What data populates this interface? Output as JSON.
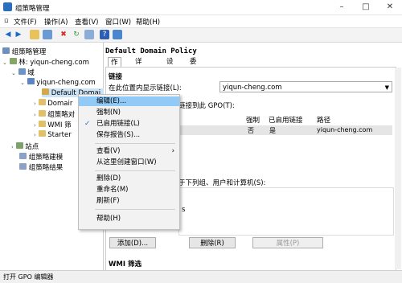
{
  "window": {
    "title": "组策略管理",
    "controls": [
      "–",
      "□",
      "✕"
    ]
  },
  "menubar": [
    {
      "label": "文件(F)"
    },
    {
      "label": "操作(A)"
    },
    {
      "label": "查看(V)"
    },
    {
      "label": "窗口(W)"
    },
    {
      "label": "帮助(H)"
    }
  ],
  "tree": {
    "root": "组策略管理",
    "forest": "林: yiqun-cheng.com",
    "domains": "域",
    "domain": "yiqun-cheng.com",
    "gpo": "Default Domai",
    "domain_ctrl": "Domair",
    "gpo_objects": "组策略对",
    "wmi": "WMI 筛",
    "starter": "Starter",
    "sites": "站点",
    "modeling": "组策略建模",
    "results": "组策略结果"
  },
  "right": {
    "gpo_title": "Default Domain Policy",
    "tabs": [
      "作用域",
      "详细信息",
      "设置",
      "委派"
    ],
    "links_header": "链接",
    "location_label": "在此位置内显示链接(L):",
    "location_value": "yiqun-cheng.com",
    "linked_label": "链接到此 GPO(T):",
    "table_headers": [
      "强制",
      "已启用链接",
      "路径"
    ],
    "table_row": {
      "enforced": "否",
      "enabled": "是",
      "path": "yiqun-cheng.com"
    },
    "filter_text": "于下列组、用户和计算机(S):",
    "filter_item": "s",
    "btn_add": "添加(D)...",
    "btn_remove": "删除(R)",
    "btn_props": "属性(P)",
    "wmi_header": "WMI 筛选"
  },
  "context_menu": [
    {
      "label": "编辑(E)...",
      "highlight": true
    },
    {
      "label": "强制(N)"
    },
    {
      "label": "已启用链接(L)",
      "checked": true
    },
    {
      "label": "保存报告(S)..."
    },
    {
      "sep": true
    },
    {
      "label": "查看(V)",
      "submenu": true
    },
    {
      "label": "从这里创建窗口(W)"
    },
    {
      "sep": true
    },
    {
      "label": "删除(D)"
    },
    {
      "label": "重命名(M)"
    },
    {
      "label": "刷新(F)"
    },
    {
      "sep": true
    },
    {
      "label": "帮助(H)"
    }
  ],
  "status": "打开 GPO 编辑器"
}
